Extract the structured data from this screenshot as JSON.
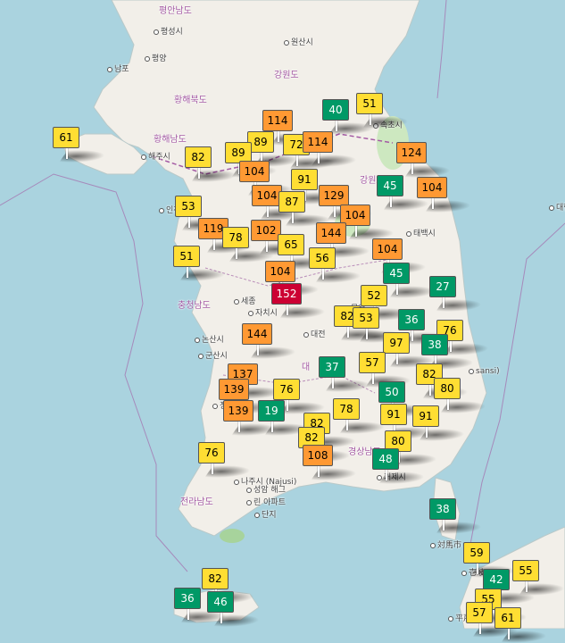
{
  "map": {
    "colors": {
      "sea": "#aad3df",
      "land": "#f2efe9",
      "good": "#009966",
      "moderate": "#ffde33",
      "usg": "#ff9933",
      "unhealthy": "#cc0033"
    },
    "place_labels": [
      {
        "id": "pyeongan-namdo",
        "text": "평안남도",
        "kind": "region"
      },
      {
        "id": "pyeongseong",
        "text": "평성시",
        "kind": "city"
      },
      {
        "id": "wonsan",
        "text": "원산시",
        "kind": "city"
      },
      {
        "id": "nampo",
        "text": "남포",
        "kind": "city"
      },
      {
        "id": "pyongyang",
        "text": "평양",
        "kind": "capital"
      },
      {
        "id": "gangwon-do-north",
        "text": "강원도",
        "kind": "region"
      },
      {
        "id": "hwanghae-bukdo",
        "text": "황해북도",
        "kind": "region"
      },
      {
        "id": "hwanghae-namdo",
        "text": "황해남도",
        "kind": "region"
      },
      {
        "id": "haeju",
        "text": "해주시",
        "kind": "city"
      },
      {
        "id": "sokcho",
        "text": "속초시",
        "kind": "city"
      },
      {
        "id": "gangwon-do-south",
        "text": "강원도",
        "kind": "region"
      },
      {
        "id": "incheon",
        "text": "인천",
        "kind": "city"
      },
      {
        "id": "taebaek",
        "text": "태백시",
        "kind": "city"
      },
      {
        "id": "chungcheong-namdo",
        "text": "충청남도",
        "kind": "region"
      },
      {
        "id": "sejong",
        "text": "세종",
        "kind": "city"
      },
      {
        "id": "jachisi",
        "text": "자치시",
        "kind": "city"
      },
      {
        "id": "daejeon",
        "text": "대전",
        "kind": "city"
      },
      {
        "id": "mungyeong",
        "text": "문경",
        "kind": "city"
      },
      {
        "id": "nonsan",
        "text": "논산시",
        "kind": "city"
      },
      {
        "id": "gunsan",
        "text": "군산시",
        "kind": "city"
      },
      {
        "id": "daegu",
        "text": "대",
        "kind": "region"
      },
      {
        "id": "sansi",
        "text": "sansi)",
        "kind": "city"
      },
      {
        "id": "jeongeup",
        "text": "정읍",
        "kind": "city"
      },
      {
        "id": "gyeongsangnam",
        "text": "경상남도",
        "kind": "region"
      },
      {
        "id": "naju",
        "text": "나주시 (Najusi)",
        "kind": "city"
      },
      {
        "id": "geoje",
        "text": "거제시",
        "kind": "city"
      },
      {
        "id": "jeollanam",
        "text": "전라남도",
        "kind": "region"
      },
      {
        "id": "seongsan",
        "text": "성암 해그",
        "kind": "city"
      },
      {
        "id": "rin-apart",
        "text": "린 아파트",
        "kind": "city"
      },
      {
        "id": "danji",
        "text": "단지",
        "kind": "city"
      },
      {
        "id": "tsushima",
        "text": "対馬市",
        "kind": "city"
      },
      {
        "id": "iki",
        "text": "壱岐",
        "kind": "city"
      },
      {
        "id": "hirado",
        "text": "平戸",
        "kind": "city"
      },
      {
        "id": "daehan",
        "text": "대한",
        "kind": "city"
      }
    ],
    "markers": [
      {
        "value": 61,
        "level": "moderate"
      },
      {
        "value": 40,
        "level": "good"
      },
      {
        "value": 51,
        "level": "moderate"
      },
      {
        "value": 114,
        "level": "usg"
      },
      {
        "value": 89,
        "level": "moderate"
      },
      {
        "value": 72,
        "level": "moderate"
      },
      {
        "value": 114,
        "level": "usg"
      },
      {
        "value": 82,
        "level": "moderate"
      },
      {
        "value": 89,
        "level": "moderate"
      },
      {
        "value": 104,
        "level": "usg"
      },
      {
        "value": 91,
        "level": "moderate"
      },
      {
        "value": 124,
        "level": "usg"
      },
      {
        "value": 45,
        "level": "good"
      },
      {
        "value": 104,
        "level": "usg"
      },
      {
        "value": 53,
        "level": "moderate"
      },
      {
        "value": 104,
        "level": "usg"
      },
      {
        "value": 87,
        "level": "moderate"
      },
      {
        "value": 129,
        "level": "usg"
      },
      {
        "value": 104,
        "level": "usg"
      },
      {
        "value": 119,
        "level": "usg"
      },
      {
        "value": 102,
        "level": "usg"
      },
      {
        "value": 78,
        "level": "moderate"
      },
      {
        "value": 65,
        "level": "moderate"
      },
      {
        "value": 144,
        "level": "usg"
      },
      {
        "value": 104,
        "level": "usg"
      },
      {
        "value": 51,
        "level": "moderate"
      },
      {
        "value": 56,
        "level": "moderate"
      },
      {
        "value": 104,
        "level": "usg"
      },
      {
        "value": 45,
        "level": "good"
      },
      {
        "value": 27,
        "level": "good"
      },
      {
        "value": 52,
        "level": "moderate"
      },
      {
        "value": 152,
        "level": "unhealthy"
      },
      {
        "value": 82,
        "level": "moderate"
      },
      {
        "value": 53,
        "level": "moderate"
      },
      {
        "value": 36,
        "level": "good"
      },
      {
        "value": 76,
        "level": "moderate"
      },
      {
        "value": 144,
        "level": "usg"
      },
      {
        "value": 97,
        "level": "moderate"
      },
      {
        "value": 38,
        "level": "good"
      },
      {
        "value": 57,
        "level": "moderate"
      },
      {
        "value": 37,
        "level": "good"
      },
      {
        "value": 137,
        "level": "usg"
      },
      {
        "value": 82,
        "level": "moderate"
      },
      {
        "value": 139,
        "level": "usg"
      },
      {
        "value": 76,
        "level": "moderate"
      },
      {
        "value": 80,
        "level": "moderate"
      },
      {
        "value": 50,
        "level": "good"
      },
      {
        "value": 139,
        "level": "usg"
      },
      {
        "value": 19,
        "level": "good"
      },
      {
        "value": 78,
        "level": "moderate"
      },
      {
        "value": 82,
        "level": "moderate"
      },
      {
        "value": 91,
        "level": "moderate"
      },
      {
        "value": 82,
        "level": "moderate"
      },
      {
        "value": 91,
        "level": "moderate"
      },
      {
        "value": 80,
        "level": "moderate"
      },
      {
        "value": 76,
        "level": "moderate"
      },
      {
        "value": 108,
        "level": "usg"
      },
      {
        "value": 48,
        "level": "good"
      },
      {
        "value": 38,
        "level": "good"
      },
      {
        "value": 59,
        "level": "moderate"
      },
      {
        "value": 55,
        "level": "moderate"
      },
      {
        "value": 42,
        "level": "good"
      },
      {
        "value": 82,
        "level": "moderate"
      },
      {
        "value": 36,
        "level": "good"
      },
      {
        "value": 46,
        "level": "good"
      },
      {
        "value": 55,
        "level": "moderate"
      },
      {
        "value": 57,
        "level": "moderate"
      },
      {
        "value": 61,
        "level": "moderate"
      }
    ]
  }
}
